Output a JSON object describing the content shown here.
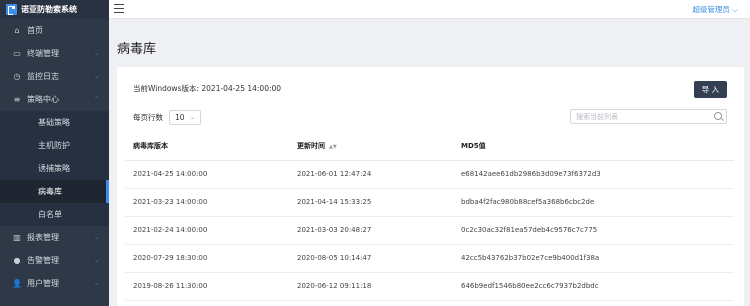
{
  "app": {
    "name": "诺亚防勒索系统",
    "accent": "#3f8fe8"
  },
  "topbar": {
    "user": "超级管理员 ⌵"
  },
  "sidebar": {
    "items": [
      {
        "label": "首页",
        "icon": "⌂"
      },
      {
        "label": "终端管理",
        "icon": "▭"
      },
      {
        "label": "监控日志",
        "icon": "◷"
      },
      {
        "label": "策略中心",
        "icon": "≡"
      }
    ],
    "subitems": [
      {
        "label": "基础策略"
      },
      {
        "label": "主机防护"
      },
      {
        "label": "诱捕策略"
      },
      {
        "label": "病毒库"
      },
      {
        "label": "白名单"
      }
    ],
    "bottom_items": [
      {
        "label": "报表管理",
        "icon": "▥"
      },
      {
        "label": "告警管理",
        "icon": "●"
      },
      {
        "label": "用户管理",
        "icon": "👤"
      }
    ]
  },
  "page": {
    "title": "病毒库",
    "version_text": "当前Windows版本: 2021-04-25 14:00:00",
    "import_label": "导 入",
    "page_size_label": "每页行数",
    "page_size_value": "10",
    "search_placeholder": "搜索当前列表"
  },
  "table": {
    "headers": [
      "病毒库版本",
      "更新时间",
      "MD5值"
    ],
    "rows": [
      [
        "2021-04-25 14:00:00",
        "2021-06-01 12:47:24",
        "e68142aee61db2986b3d09e73f6372d3"
      ],
      [
        "2021-03-23 14:00:00",
        "2021-04-14 15:33:25",
        "bdba4f2fac980b88cef5a368b6cbc2de"
      ],
      [
        "2021-02-24 14:00:00",
        "2021-03-03 20:48:27",
        "0c2c30ac32f81ea57deb4c9576c7c775"
      ],
      [
        "2020-07-29 18:30:00",
        "2020-08-05 10:14:47",
        "42cc5b43762b37b02e7ce9b400d1f38a"
      ],
      [
        "2019-08-26 11:30:00",
        "2020-06-12 09:11:18",
        "646b9edf1546b80ee2cc6c7937b2dbdc"
      ]
    ]
  }
}
